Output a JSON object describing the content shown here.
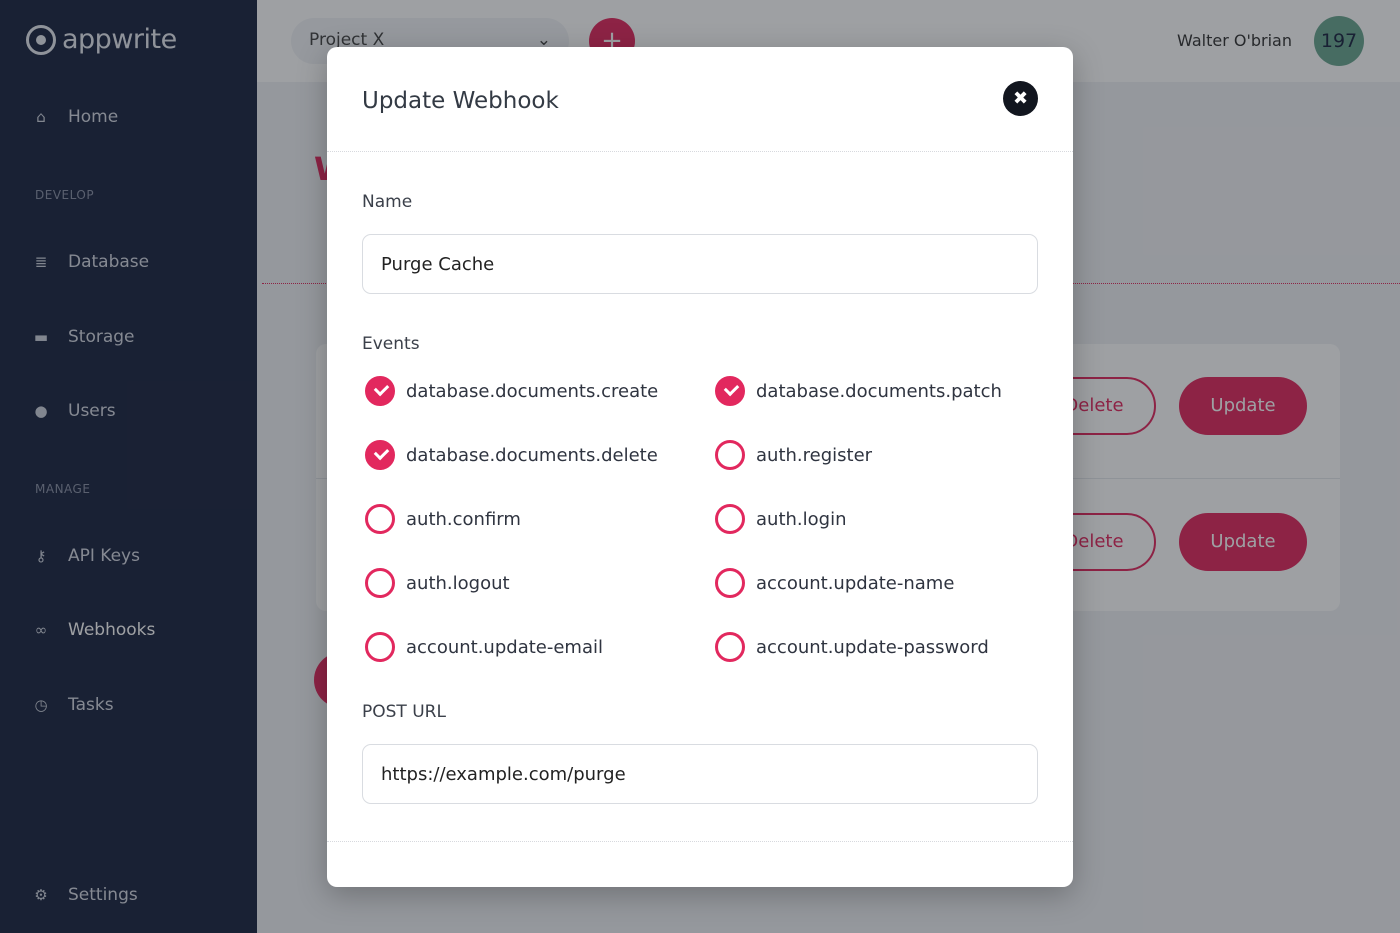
{
  "app": {
    "logo_text": "appwrite"
  },
  "sidebar": {
    "home": "Home",
    "develop_label": "DEVELOP",
    "database": "Database",
    "storage": "Storage",
    "users": "Users",
    "manage_label": "MANAGE",
    "api_keys": "API Keys",
    "webhooks": "Webhooks",
    "tasks": "Tasks",
    "settings": "Settings"
  },
  "topbar": {
    "project": "Project X",
    "add_label": "+",
    "username": "Walter O'brian",
    "avatar_text": "197"
  },
  "background": {
    "heading_initial": "W",
    "rows": [
      {
        "delete_label": "Delete",
        "update_label": "Update"
      },
      {
        "delete_label": "Delete",
        "update_label": "Update"
      }
    ]
  },
  "modal": {
    "title": "Update Webhook",
    "close_symbol": "✖",
    "name_label": "Name",
    "name_value": "Purge Cache",
    "events_label": "Events",
    "events": [
      {
        "label": "database.documents.create",
        "checked": true
      },
      {
        "label": "database.documents.patch",
        "checked": true
      },
      {
        "label": "database.documents.delete",
        "checked": true
      },
      {
        "label": "auth.register",
        "checked": false
      },
      {
        "label": "auth.confirm",
        "checked": false
      },
      {
        "label": "auth.login",
        "checked": false
      },
      {
        "label": "auth.logout",
        "checked": false
      },
      {
        "label": "account.update-name",
        "checked": false
      },
      {
        "label": "account.update-email",
        "checked": false
      },
      {
        "label": "account.update-password",
        "checked": false
      }
    ],
    "url_label": "POST URL",
    "url_value": "https://example.com/purge"
  },
  "colors": {
    "accent": "#e2285e",
    "sidebar": "#1b2540"
  }
}
